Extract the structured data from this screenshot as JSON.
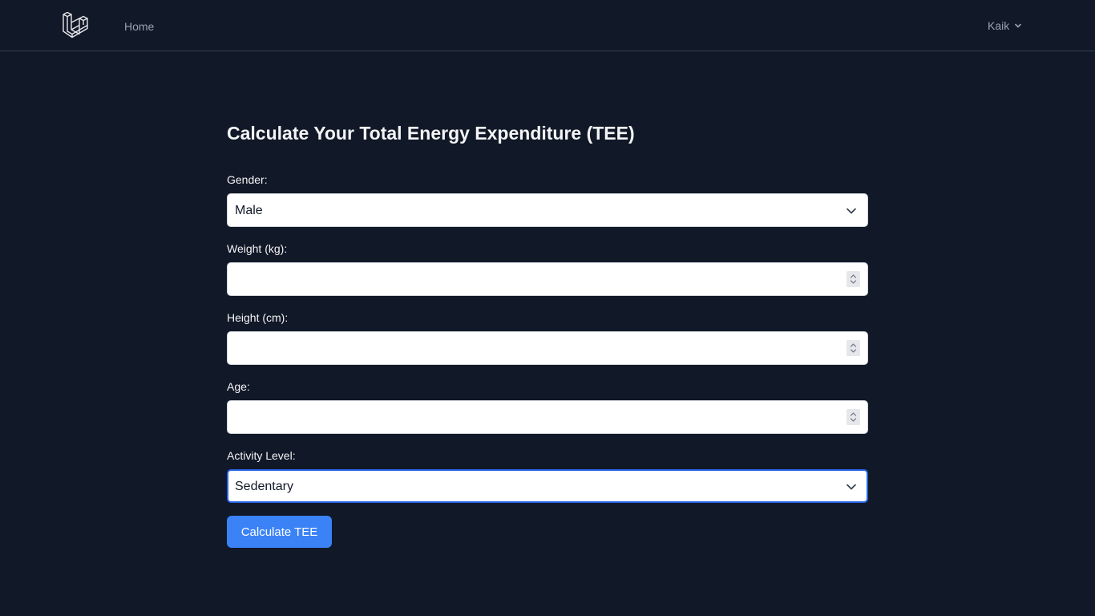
{
  "nav": {
    "logo_icon": "laravel-logo-icon",
    "home_label": "Home",
    "user_name": "Kaik",
    "user_menu_icon": "chevron-down-icon"
  },
  "form": {
    "title": "Calculate Your Total Energy Expenditure (TEE)",
    "gender": {
      "label": "Gender:",
      "value": "Male"
    },
    "weight": {
      "label": "Weight (kg):",
      "value": ""
    },
    "height": {
      "label": "Height (cm):",
      "value": ""
    },
    "age": {
      "label": "Age:",
      "value": ""
    },
    "activity": {
      "label": "Activity Level:",
      "value": "Sedentary"
    },
    "submit_label": "Calculate TEE"
  },
  "colors": {
    "background": "#111827",
    "accent": "#3b82f6",
    "focus_border": "#2563eb"
  }
}
